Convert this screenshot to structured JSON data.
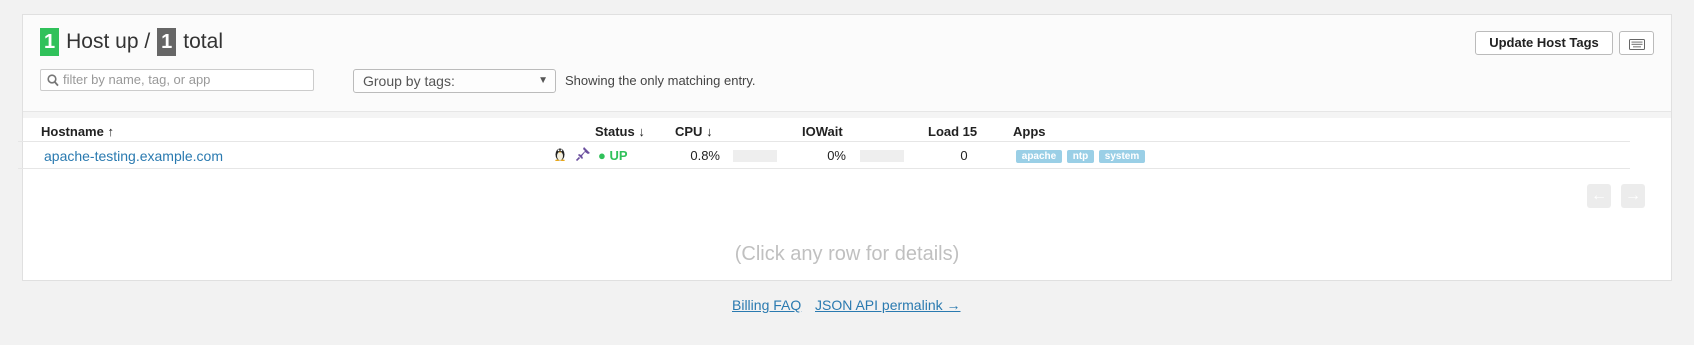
{
  "header": {
    "hosts_up": "1",
    "title_up": "Host up /",
    "hosts_total": "1",
    "title_total": "total",
    "filter_placeholder": "filter by name, tag, or app",
    "group_by_label": "Group by tags:",
    "showing_text": "Showing the only matching entry.",
    "update_button": "Update Host Tags"
  },
  "table": {
    "columns": [
      {
        "label": "Hostname",
        "sort": "↑"
      },
      {
        "label": "Status",
        "sort": "↓"
      },
      {
        "label": "CPU",
        "sort": "↓"
      },
      {
        "label": "IOWait",
        "sort": ""
      },
      {
        "label": "Load 15",
        "sort": ""
      },
      {
        "label": "Apps",
        "sort": ""
      }
    ],
    "rows": [
      {
        "hostname": "apache-testing.example.com",
        "os_icon": "linux-penguin-icon",
        "extra_icon": "pin-icon",
        "status": "● UP",
        "cpu": "0.8%",
        "cpu_fraction": 0.008,
        "iowait": "0%",
        "iowait_fraction": 0,
        "load15": "0",
        "apps": [
          "apache",
          "ntp",
          "system"
        ]
      }
    ]
  },
  "pagination": {
    "prev": "←",
    "next": "→"
  },
  "details_hint": "(Click any row for details)",
  "footer": {
    "billing_faq": "Billing FAQ",
    "json_api": "JSON API permalink →"
  },
  "colors": {
    "up_green": "#30c15a",
    "total_gray": "#666666",
    "link_blue": "#2a7ab0",
    "tag_blue": "#9acfe6"
  }
}
